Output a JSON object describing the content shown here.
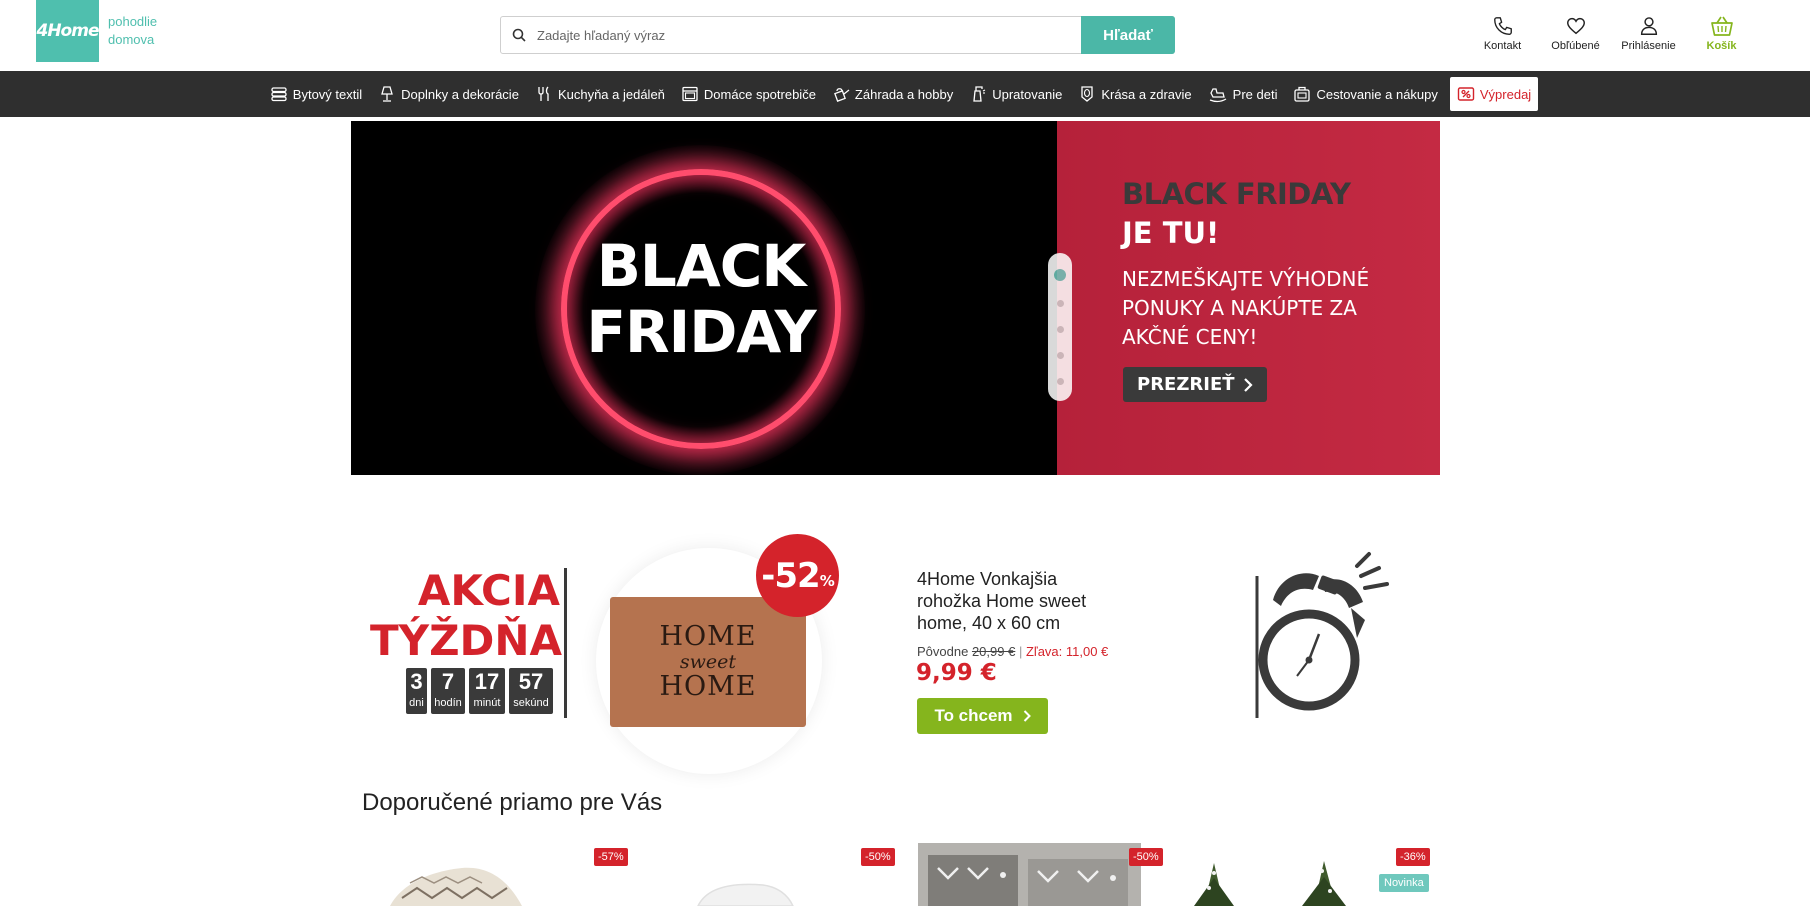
{
  "header": {
    "logo": "4Home",
    "tagline_line1": "pohodlie",
    "tagline_line2": "domova",
    "search": {
      "placeholder": "Zadajte hľadaný výraz",
      "button": "Hľadať"
    },
    "links": [
      {
        "label": "Kontakt",
        "icon": "phone-icon"
      },
      {
        "label": "Obľúbené",
        "icon": "heart-icon"
      },
      {
        "label": "Prihlásenie",
        "icon": "user-icon"
      },
      {
        "label": "Košík",
        "icon": "basket-icon"
      }
    ]
  },
  "nav": {
    "items": [
      {
        "label": "Bytový textil",
        "icon": "towels-icon"
      },
      {
        "label": "Doplnky a dekorácie",
        "icon": "lamp-icon"
      },
      {
        "label": "Kuchyňa a jedáleň",
        "icon": "cutlery-icon"
      },
      {
        "label": "Domáce spotrebiče",
        "icon": "oven-icon"
      },
      {
        "label": "Záhrada a hobby",
        "icon": "watering-can-icon"
      },
      {
        "label": "Upratovanie",
        "icon": "spray-icon"
      },
      {
        "label": "Krása a zdravie",
        "icon": "mirror-icon"
      },
      {
        "label": "Pre deti",
        "icon": "rocking-horse-icon"
      },
      {
        "label": "Cestovanie a nákupy",
        "icon": "luggage-icon"
      }
    ],
    "sale": {
      "label": "Výpredaj",
      "icon": "sale-tag-icon"
    }
  },
  "hero": {
    "left_line1": "BLACK",
    "left_line2": "FRIDAY",
    "right_title1": "BLACK FRIDAY",
    "right_title2": "JE TU!",
    "right_sub": "NEZMEŠKAJTE VÝHODNÉ PONUKY A NAKÚPTE ZA AKČNÉ CENY!",
    "button": "PREZRIEŤ",
    "slides_count": 5,
    "active_slide": 1
  },
  "deal": {
    "title_line1": "AKCIA",
    "title_line2": "TÝŽDŇA",
    "countdown": [
      {
        "value": "3",
        "label": "dni"
      },
      {
        "value": "7",
        "label": "hodín"
      },
      {
        "value": "17",
        "label": "minút"
      },
      {
        "value": "57",
        "label": "sekúnd"
      }
    ],
    "discount": "-52",
    "discount_unit": "%",
    "mat_text1": "HOME",
    "mat_text2": "sweet",
    "mat_text3": "HOME",
    "product_name": "4Home Vonkajšia rohožka Home sweet home, 40 x 60 cm",
    "original_label": "Pôvodne",
    "original_price": "20,99 €",
    "separator": "|",
    "savings": "Zľava: 11,00 €",
    "price": "9,99 €",
    "button": "To chcem"
  },
  "recommended": {
    "title": "Doporučené priamo pre Vás",
    "products": [
      {
        "badge": "-57%"
      },
      {
        "badge": "-50%"
      },
      {
        "badge": "-50%"
      },
      {
        "badge": "-36%",
        "tag": "Novinka"
      }
    ]
  },
  "colors": {
    "brand": "#4fbfae",
    "nav_bg": "#2f2f2f",
    "accent_red": "#d4232b",
    "cta_green": "#85b51d"
  }
}
